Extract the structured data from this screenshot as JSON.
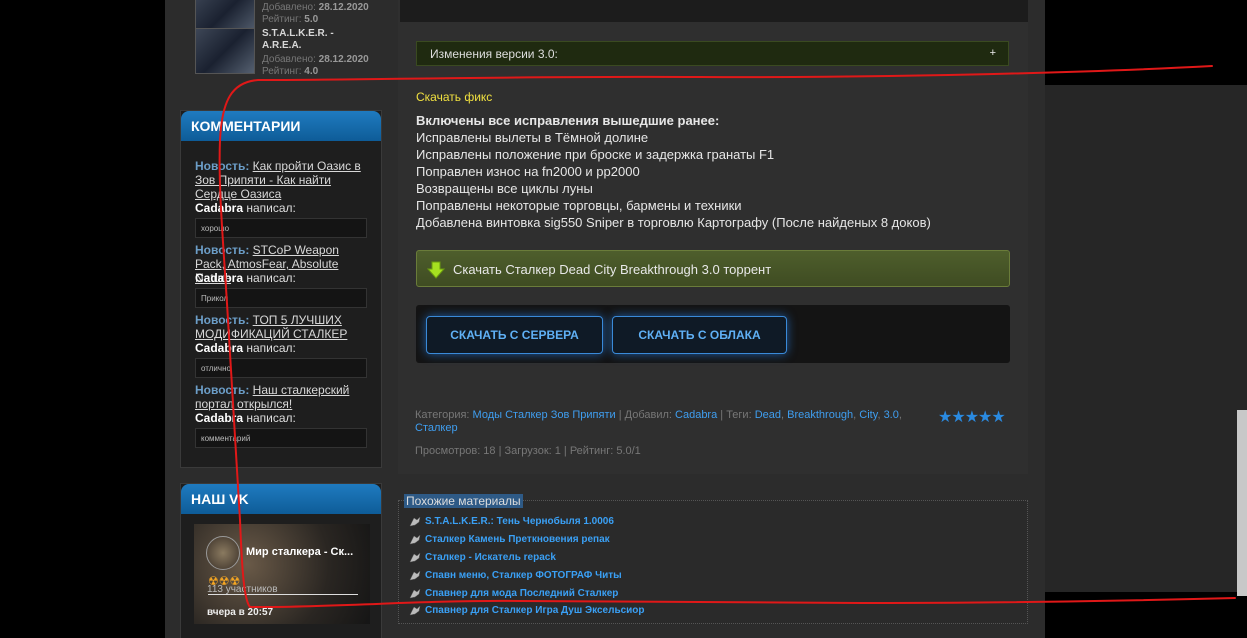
{
  "sidebar": {
    "new_items": [
      {
        "title": "",
        "added_label": "Добавлено:",
        "added": "28.12.2020",
        "rating_label": "Рейтинг:",
        "rating": "5.0"
      },
      {
        "title": "S.T.A.L.K.E.R. - A.R.E.A.",
        "added_label": "Добавлено:",
        "added": "28.12.2020",
        "rating_label": "Рейтинг:",
        "rating": "4.0"
      }
    ],
    "comments": {
      "title": "КОММЕНТАРИИ",
      "items": [
        {
          "news_label": "Новость:",
          "link": "Как пройти Оазис в Зов Припяти - Как найти Сердце Оазиса",
          "author": "Cadabra",
          "wrote": "написал:",
          "text": "хорошо"
        },
        {
          "news_label": "Новость:",
          "link": "STCoP Weapon Pack, AtmosFear, Absolute Nature",
          "author": "Cadabra",
          "wrote": "написал:",
          "text": "Прикол"
        },
        {
          "news_label": "Новость:",
          "link": "ТОП 5 ЛУЧШИХ МОДИФИКАЦИЙ СТАЛКЕР",
          "author": "Cadabra",
          "wrote": "написал:",
          "text": "отлично"
        },
        {
          "news_label": "Новость:",
          "link": "Наш сталкерский портал открылся!",
          "author": "Cadabra",
          "wrote": "написал:",
          "text": "комментарий"
        }
      ]
    },
    "vk": {
      "title": "НАШ VK",
      "group_name": "Мир сталкера - Ск...",
      "emoji": "☢☢☢",
      "members": "113 участников",
      "date": "вчера в 20:57"
    }
  },
  "main": {
    "changes_label": "Изменения версии 3.0:",
    "changes_toggle": "+",
    "fix_link": "Скачать фикс",
    "fixes": [
      "Включены все исправления вышедшие ранее:",
      "Исправлены вылеты в Тёмной долине",
      "Исправлены положение при броске и задержка гранаты F1",
      "Поправлен износ на fn2000 и pp2000",
      "Возвращены все циклы луны",
      "Поправлены некоторые торговцы, бармены и техники",
      "Добавлена винтовка sig550 Sniper в торговлю Картографу (После найденых 8 доков)"
    ],
    "torrent_label": "Скачать Сталкер Dead City Breakthrough 3.0 торрент",
    "download_server": "СКАЧАТЬ С СЕРВЕРА",
    "download_cloud": "СКАЧАТЬ С ОБЛАКА",
    "meta": {
      "category_label": "Категория:",
      "category": "Моды Сталкер Зов Припяти",
      "added_by_label": "Добавил:",
      "added_by": "Cadabra",
      "tags_label": "Теги:",
      "tags": [
        "Dead",
        "Breakthrough",
        "City",
        "3.0",
        "Сталкер"
      ],
      "stats": "Просмотров: 18 | Загрузок: 1 | Рейтинг: 5.0/1",
      "stars": "★★★★★"
    }
  },
  "related": {
    "title": "Похожие материалы",
    "items": [
      "S.T.A.L.K.E.R.: Тень Чернобыля 1.0006",
      "Сталкер Камень Преткновения репак",
      "Сталкер - Искатель repack",
      "Спавн меню, Сталкер ФОТОГРАФ Читы",
      "Спавнер для мода Последний Сталкер",
      "Спавнер для Сталкер Игра Душ Эксельсиор"
    ]
  },
  "colors": {
    "accent_blue": "#3aa0f5",
    "header_blue": "#1f7bc0",
    "fix_yellow": "#f0e040",
    "torrent_green": "#4e5e2c",
    "scribble_red": "#e01818"
  }
}
